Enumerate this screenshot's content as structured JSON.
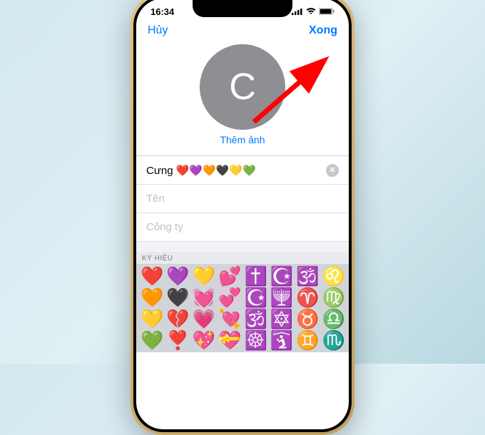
{
  "status": {
    "time": "16:34"
  },
  "nav": {
    "cancel": "Hủy",
    "done": "Xong"
  },
  "avatar": {
    "letter": "C",
    "add_photo": "Thêm ảnh"
  },
  "form": {
    "name_value": "Cưng ❤️💜🧡🖤💛💚",
    "ten_placeholder": "Tên",
    "congty_placeholder": "Công ty"
  },
  "keyboard": {
    "section_label": "KÝ HIỆU",
    "rows": [
      [
        "❤️",
        "💜",
        "💛",
        "💕",
        "✝️",
        "☪️",
        "🕉️",
        "♌"
      ],
      [
        "🧡",
        "🖤",
        "💓",
        "💞",
        "☪️",
        "🕎",
        "♈",
        "♍"
      ],
      [
        "💛",
        "💔",
        "💗",
        "💘",
        "🕉️",
        "🔯",
        "♉",
        "♎"
      ],
      [
        "💚",
        "❣️",
        "💖",
        "💝",
        "☸️",
        "🛐",
        "♊",
        "♏"
      ]
    ]
  }
}
